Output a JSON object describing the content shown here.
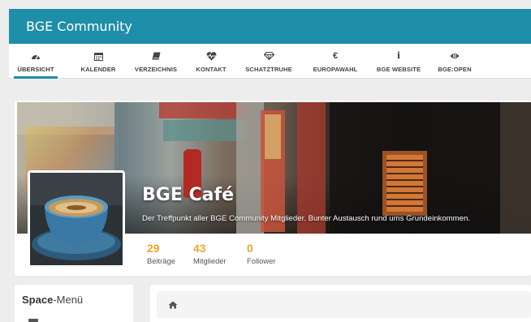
{
  "app": {
    "title": "BGE Community"
  },
  "nav": {
    "items": [
      {
        "label": "ÜBERSICHT",
        "icon": "dashboard-icon",
        "active": true
      },
      {
        "label": "KALENDER",
        "icon": "calendar-icon"
      },
      {
        "label": "VERZEICHNIS",
        "icon": "book-icon"
      },
      {
        "label": "KONTAKT",
        "icon": "heartbeat-icon"
      },
      {
        "label": "SCHATZTRUHE",
        "icon": "diamond-icon"
      },
      {
        "label": "EUROPAWAHL",
        "icon": "euro-icon"
      },
      {
        "label": "BGE WEBSITE",
        "icon": "info-icon"
      },
      {
        "label": "BGE:OPEN",
        "icon": "eye-icon"
      }
    ]
  },
  "space": {
    "title": "BGE Café",
    "description": "Der Treffpunkt aller BGE Community Mitglieder. Bunter Austausch rund ums Grundeinkommen.",
    "stats": [
      {
        "value": "29",
        "label": "Beiträge"
      },
      {
        "value": "43",
        "label": "Mitglieder"
      },
      {
        "value": "0",
        "label": "Follower"
      }
    ]
  },
  "sidebar": {
    "title_bold": "Space",
    "title_rest": "-Menü"
  },
  "colors": {
    "brand": "#1f8ea8",
    "accent": "#f0a32e"
  }
}
